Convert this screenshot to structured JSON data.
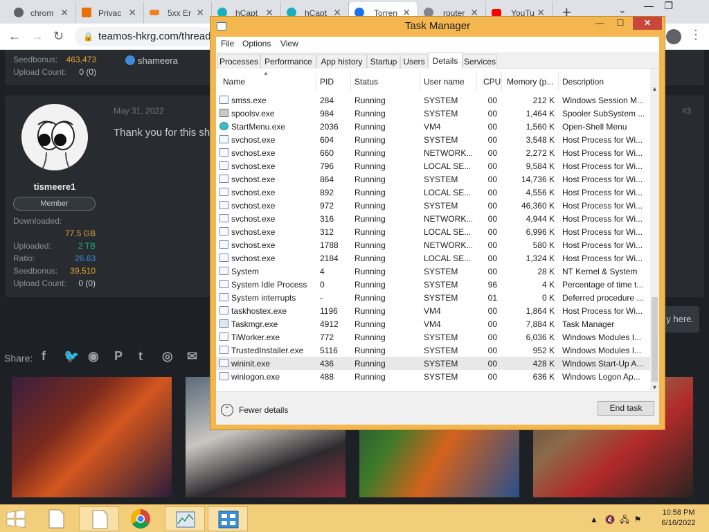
{
  "browser": {
    "tabs": [
      {
        "label": "chrom",
        "icon": "chrome-icon"
      },
      {
        "label": "Privac",
        "icon": "cloudflare-icon"
      },
      {
        "label": "5xx Er",
        "icon": "cloudflare-orange-icon"
      },
      {
        "label": "hCapt",
        "icon": "hcaptcha-icon"
      },
      {
        "label": "hCapt",
        "icon": "hcaptcha-icon"
      },
      {
        "label": "Torren",
        "icon": "torrent-icon"
      },
      {
        "label": "router",
        "icon": "globe-icon"
      },
      {
        "label": "YouTu",
        "icon": "youtube-icon"
      }
    ],
    "url": "teamos-hkrg.com/threads"
  },
  "forum": {
    "prev_user": {
      "seedbonus_label": "Seedbonus:",
      "seedbonus_value": "463,473",
      "upload_count_label": "Upload Count:",
      "upload_count_value": "0 (0)",
      "likes_user": "shameera"
    },
    "post": {
      "date": "May 31, 2022",
      "number": "#3",
      "text": "Thank you for this sh",
      "username": "tismeere1",
      "role": "Member",
      "downloaded_label": "Downloaded:",
      "downloaded_value": "77.5 GB",
      "uploaded_label": "Uploaded:",
      "uploaded_value": "2 TB",
      "ratio_label": "Ratio:",
      "ratio_value": "26.63",
      "seedbonus_label": "Seedbonus:",
      "seedbonus_value": "39,510",
      "upload_count_label": "Upload Count:",
      "upload_count_value": "0 (0)"
    },
    "share_label": "Share:",
    "reply_hint": "y here."
  },
  "task_manager": {
    "title": "Task Manager",
    "menu": [
      "File",
      "Options",
      "View"
    ],
    "tabs": [
      "Processes",
      "Performance",
      "App history",
      "Startup",
      "Users",
      "Details",
      "Services"
    ],
    "active_tab": "Details",
    "columns": [
      "Name",
      "PID",
      "Status",
      "User name",
      "CPU",
      "Memory (p...",
      "Description"
    ],
    "rows": [
      {
        "name": "smss.exe",
        "pid": "284",
        "status": "Running",
        "user": "SYSTEM",
        "cpu": "00",
        "mem": "212 K",
        "desc": "Windows Session M...",
        "icon": "default"
      },
      {
        "name": "spoolsv.exe",
        "pid": "984",
        "status": "Running",
        "user": "SYSTEM",
        "cpu": "00",
        "mem": "1,464 K",
        "desc": "Spooler SubSystem ...",
        "icon": "printer"
      },
      {
        "name": "StartMenu.exe",
        "pid": "2036",
        "status": "Running",
        "user": "VM4",
        "cpu": "00",
        "mem": "1,560 K",
        "desc": "Open-Shell Menu",
        "icon": "start"
      },
      {
        "name": "svchost.exe",
        "pid": "604",
        "status": "Running",
        "user": "SYSTEM",
        "cpu": "00",
        "mem": "3,548 K",
        "desc": "Host Process for Wi...",
        "icon": "default"
      },
      {
        "name": "svchost.exe",
        "pid": "660",
        "status": "Running",
        "user": "NETWORK...",
        "cpu": "00",
        "mem": "2,272 K",
        "desc": "Host Process for Wi...",
        "icon": "default"
      },
      {
        "name": "svchost.exe",
        "pid": "796",
        "status": "Running",
        "user": "LOCAL SE...",
        "cpu": "00",
        "mem": "9,584 K",
        "desc": "Host Process for Wi...",
        "icon": "default"
      },
      {
        "name": "svchost.exe",
        "pid": "864",
        "status": "Running",
        "user": "SYSTEM",
        "cpu": "00",
        "mem": "14,736 K",
        "desc": "Host Process for Wi...",
        "icon": "default"
      },
      {
        "name": "svchost.exe",
        "pid": "892",
        "status": "Running",
        "user": "LOCAL SE...",
        "cpu": "00",
        "mem": "4,556 K",
        "desc": "Host Process for Wi...",
        "icon": "default"
      },
      {
        "name": "svchost.exe",
        "pid": "972",
        "status": "Running",
        "user": "SYSTEM",
        "cpu": "00",
        "mem": "46,360 K",
        "desc": "Host Process for Wi...",
        "icon": "default"
      },
      {
        "name": "svchost.exe",
        "pid": "316",
        "status": "Running",
        "user": "NETWORK...",
        "cpu": "00",
        "mem": "4,944 K",
        "desc": "Host Process for Wi...",
        "icon": "default"
      },
      {
        "name": "svchost.exe",
        "pid": "312",
        "status": "Running",
        "user": "LOCAL SE...",
        "cpu": "00",
        "mem": "6,996 K",
        "desc": "Host Process for Wi...",
        "icon": "default"
      },
      {
        "name": "svchost.exe",
        "pid": "1788",
        "status": "Running",
        "user": "NETWORK...",
        "cpu": "00",
        "mem": "580 K",
        "desc": "Host Process for Wi...",
        "icon": "default"
      },
      {
        "name": "svchost.exe",
        "pid": "2184",
        "status": "Running",
        "user": "LOCAL SE...",
        "cpu": "00",
        "mem": "1,324 K",
        "desc": "Host Process for Wi...",
        "icon": "default"
      },
      {
        "name": "System",
        "pid": "4",
        "status": "Running",
        "user": "SYSTEM",
        "cpu": "00",
        "mem": "28 K",
        "desc": "NT Kernel & System",
        "icon": "default"
      },
      {
        "name": "System Idle Process",
        "pid": "0",
        "status": "Running",
        "user": "SYSTEM",
        "cpu": "96",
        "mem": "4 K",
        "desc": "Percentage of time t...",
        "icon": "default"
      },
      {
        "name": "System interrupts",
        "pid": "-",
        "status": "Running",
        "user": "SYSTEM",
        "cpu": "01",
        "mem": "0 K",
        "desc": "Deferred procedure ...",
        "icon": "default"
      },
      {
        "name": "taskhostex.exe",
        "pid": "1196",
        "status": "Running",
        "user": "VM4",
        "cpu": "00",
        "mem": "1,864 K",
        "desc": "Host Process for Wi...",
        "icon": "default"
      },
      {
        "name": "Taskmgr.exe",
        "pid": "4912",
        "status": "Running",
        "user": "VM4",
        "cpu": "00",
        "mem": "7,884 K",
        "desc": "Task Manager",
        "icon": "tmgr"
      },
      {
        "name": "TiWorker.exe",
        "pid": "772",
        "status": "Running",
        "user": "SYSTEM",
        "cpu": "00",
        "mem": "6,036 K",
        "desc": "Windows Modules I...",
        "icon": "default"
      },
      {
        "name": "TrustedInstaller.exe",
        "pid": "5116",
        "status": "Running",
        "user": "SYSTEM",
        "cpu": "00",
        "mem": "952 K",
        "desc": "Windows Modules I...",
        "icon": "default"
      },
      {
        "name": "wininit.exe",
        "pid": "436",
        "status": "Running",
        "user": "SYSTEM",
        "cpu": "00",
        "mem": "428 K",
        "desc": "Windows Start-Up A...",
        "icon": "default",
        "selected": true
      },
      {
        "name": "winlogon.exe",
        "pid": "488",
        "status": "Running",
        "user": "SYSTEM",
        "cpu": "00",
        "mem": "636 K",
        "desc": "Windows Logon Ap...",
        "icon": "default"
      }
    ],
    "fewer_details": "Fewer details",
    "end_task": "End task"
  },
  "taskbar": {
    "time": "10:58 PM",
    "date": "6/16/2022"
  },
  "colors": {
    "window_frame": "#f4b750",
    "taskbar": "#f3ce7a",
    "close_button": "#c7483b",
    "forum_bg": "#1d2125",
    "downloaded": "#e0a030",
    "uploaded": "#1fa87a",
    "ratio": "#3f8ae0",
    "seedbonus": "#e0a030"
  }
}
